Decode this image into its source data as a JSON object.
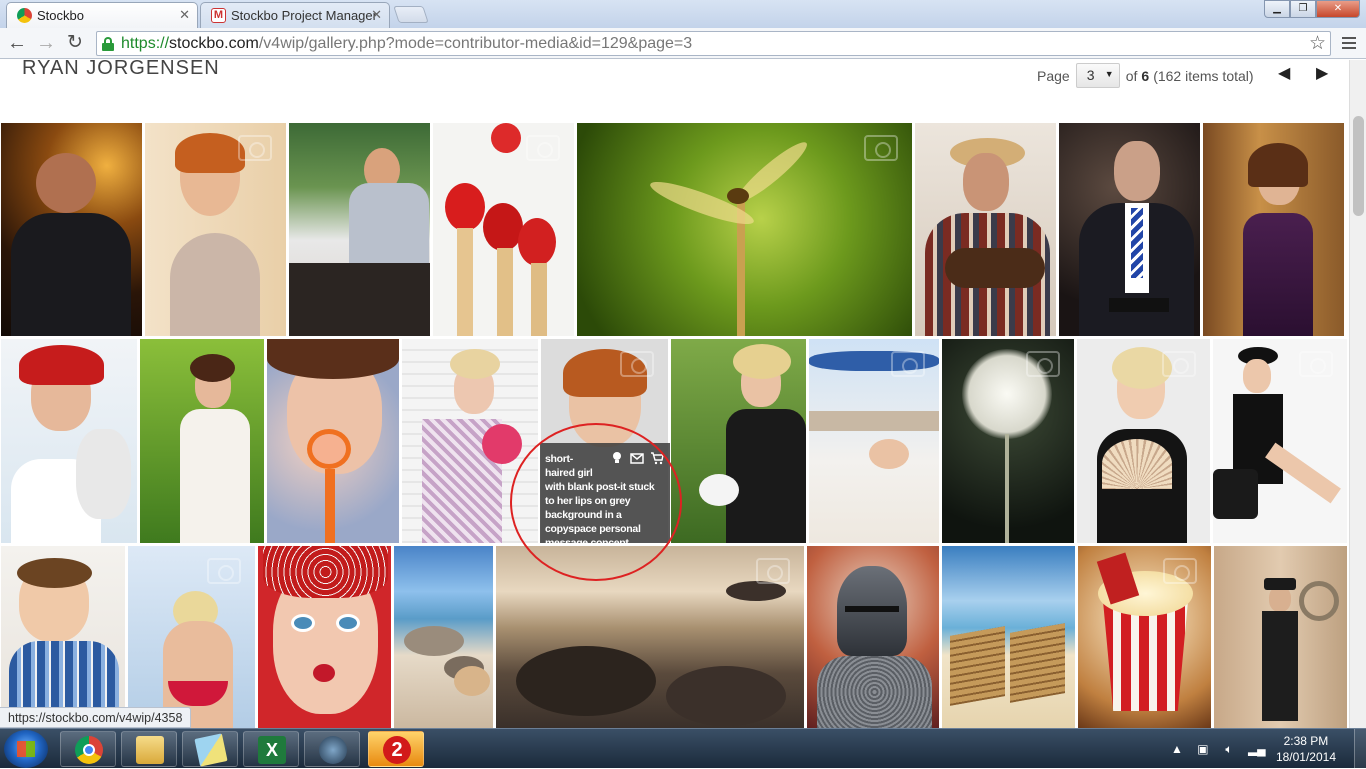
{
  "browser": {
    "tabs": [
      {
        "label": "Stockbo",
        "active": true,
        "favicon": "chrome-icon"
      },
      {
        "label": "Stockbo Project Manager",
        "active": false,
        "favicon": "gmail-icon"
      }
    ],
    "url": {
      "scheme": "https://",
      "host": "stockbo.com",
      "path": "/v4wip/gallery.php?mode=contributor-media&id=129&page=3"
    },
    "status_url": "https://stockbo.com/v4wip/4358"
  },
  "gallery": {
    "contributor_name": "RYAN JORGENSEN",
    "pager": {
      "label": "Page",
      "current": "3",
      "of_label": "of",
      "total_pages": "6",
      "items_text": "(162 items total)"
    },
    "hover_tooltip": {
      "title": "short-haired girl",
      "description": "with blank post-it stuck to her lips on grey background in a copyspace personal message concept",
      "actions": [
        "lightbox-icon",
        "email-icon",
        "cart-icon"
      ]
    },
    "thumbnails": [
      {
        "subject": "man drinking at bar"
      },
      {
        "subject": "short-haired woman"
      },
      {
        "subject": "businessman at restaurant table"
      },
      {
        "subject": "red matches"
      },
      {
        "subject": "dragonfly on twig"
      },
      {
        "subject": "cowboy with guitar"
      },
      {
        "subject": "businessman with tablet"
      },
      {
        "subject": "woman in purple dress"
      },
      {
        "subject": "woman with red bandana"
      },
      {
        "subject": "woman with tin can phone"
      },
      {
        "subject": "woman with heart magnifier"
      },
      {
        "subject": "woman with lace fabric"
      },
      {
        "subject": "short-haired girl with post-it"
      },
      {
        "subject": "woman watering garden"
      },
      {
        "subject": "woman on beach"
      },
      {
        "subject": "dandelion seed head"
      },
      {
        "subject": "blonde woman with fan"
      },
      {
        "subject": "woman in black dress and hat"
      },
      {
        "subject": "smiling boy"
      },
      {
        "subject": "woman in red bikini"
      },
      {
        "subject": "surprised woman with bandana"
      },
      {
        "subject": "rocky beach"
      },
      {
        "subject": "sunset rocks"
      },
      {
        "subject": "knight in armour"
      },
      {
        "subject": "beach deck chairs"
      },
      {
        "subject": "popcorn box"
      },
      {
        "subject": "man with top hat"
      }
    ]
  },
  "taskbar": {
    "apps": [
      "chrome-icon",
      "explorer-icon",
      "notes-icon",
      "excel-icon",
      "media-icon",
      "app-2-icon"
    ],
    "time": "2:38 PM",
    "date": "18/01/2014"
  },
  "colors": {
    "annotation": "#dd2222",
    "url_scheme": "#1e8a2c"
  }
}
